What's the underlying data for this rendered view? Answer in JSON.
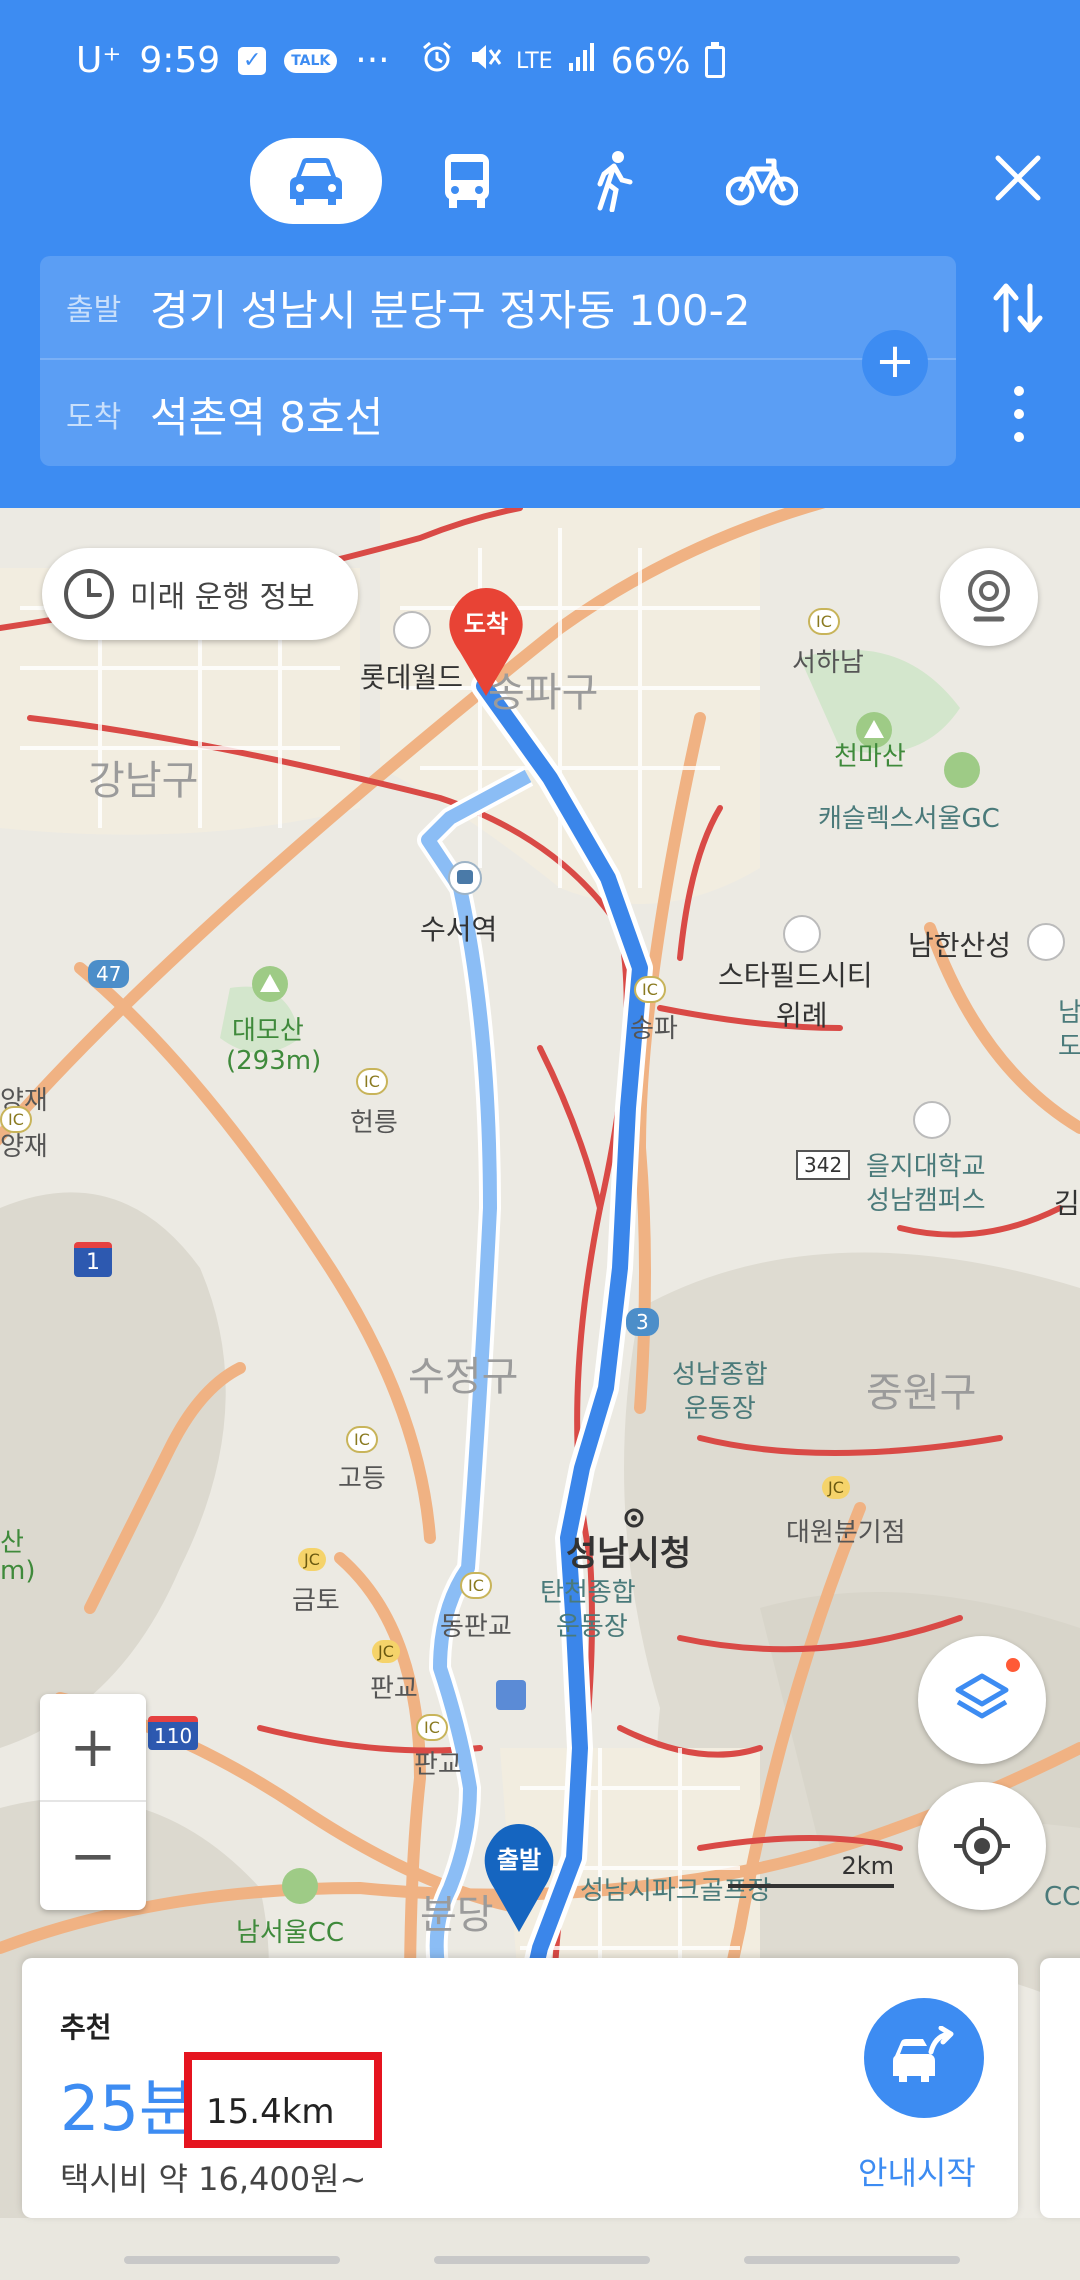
{
  "status_bar": {
    "carrier": "U⁺",
    "time": "9:59",
    "talk_badge": "TALK",
    "more": "···",
    "network": "LTE",
    "battery": "66%"
  },
  "modes": {
    "car": "car",
    "bus": "bus",
    "walk": "walk",
    "bike": "bike",
    "active": "car"
  },
  "route": {
    "origin_label": "출발",
    "origin_value": "경기 성남시 분당구 정자동 100-2",
    "dest_label": "도착",
    "dest_value": "석촌역 8호선",
    "add_symbol": "+"
  },
  "map": {
    "future_info": "미래 운행 정보",
    "dest_pin": "도착",
    "start_pin": "출발",
    "scale": "2km",
    "zoom_in": "+",
    "zoom_out": "−",
    "labels": {
      "songpa_gu": "송파구",
      "gangnam_gu": "강남구",
      "lotte_world": "롯데월드",
      "seohanam": "서하남",
      "cheonmasan": "천마산",
      "castle_gc": "캐슬렉스서울GC",
      "namhansanseong": "남한산성",
      "starfield": "스타필드시티",
      "wirye": "위례",
      "suseo": "수서역",
      "songpa_ic": "송파",
      "daemosan": "대모산",
      "daemosan_h": "(293m)",
      "heolleung": "헌릉",
      "yangjae1": "양재",
      "yangjae2": "양재",
      "eulji_univ": "을지대학교",
      "eulji_campus": "성남캠퍼스",
      "sujeong_gu": "수정구",
      "seongnam_sports1": "성남종합",
      "seongnam_sports2": "운동장",
      "jungwon_gu": "중원구",
      "godeung": "고등",
      "seongnam_cityhall": "성남시청",
      "tancheon1": "탄천종합",
      "tancheon2": "운동장",
      "geumto": "금토",
      "dongpangyo": "동판교",
      "daewon": "대원분기점",
      "pangyo1": "판교",
      "pangyo2": "판교",
      "bundang": "분당",
      "namseoul_cc": "남서울CC",
      "parkgolf": "성남시파크골프장",
      "san": "산",
      "m": "m)",
      "road_47": "47",
      "road_1": "1",
      "road_3": "3",
      "road_342": "342",
      "road_110": "110",
      "ic": "IC",
      "jc": "JC",
      "nam": "남",
      "do": "도",
      "cc": "CC"
    }
  },
  "card": {
    "recommend": "추천",
    "duration": "25분",
    "distance": "15.4km",
    "fare": "택시비 약 16,400원~",
    "nav_start": "안내시작"
  },
  "colors": {
    "primary_blue": "#3d8cf2",
    "route_main": "#3b86ea",
    "route_alt": "#8bbdf5",
    "highlight_red": "#e5141f",
    "dest_pin": "#e84335",
    "start_pin": "#1565c0"
  }
}
